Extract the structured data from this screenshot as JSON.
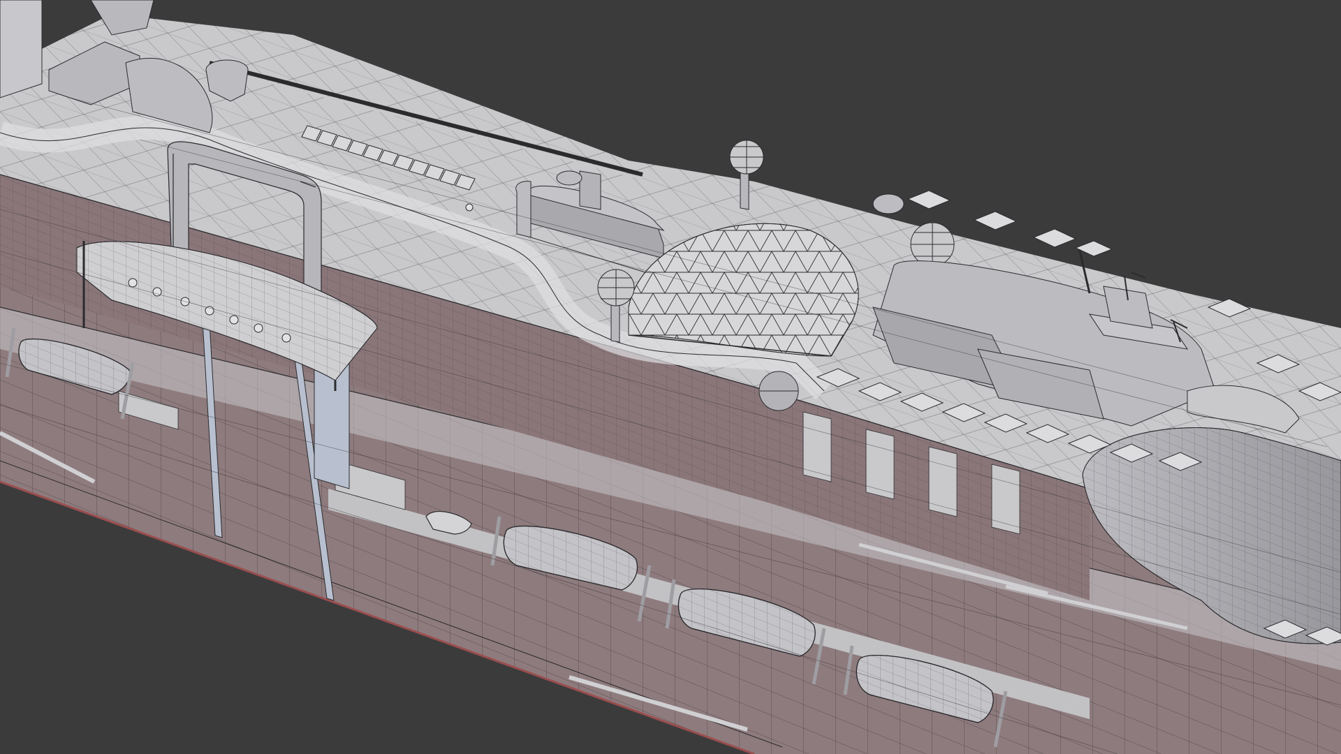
{
  "scene": {
    "subject": "cruise-ship-wireframe",
    "background_color": "#3b3b3c",
    "hull_color": "#8e7b7d",
    "hull_shade_color": "#7f6d70",
    "deck_color": "#c9c9cc",
    "superstructure_color": "#b4b3b7",
    "wire_color": "#2b2b2e",
    "accent_edge_color": "#9a4e4e",
    "lifeboat_count": 4,
    "radar_dome_count": 4,
    "umbrella_count": 18,
    "sunbed_count": 18
  }
}
